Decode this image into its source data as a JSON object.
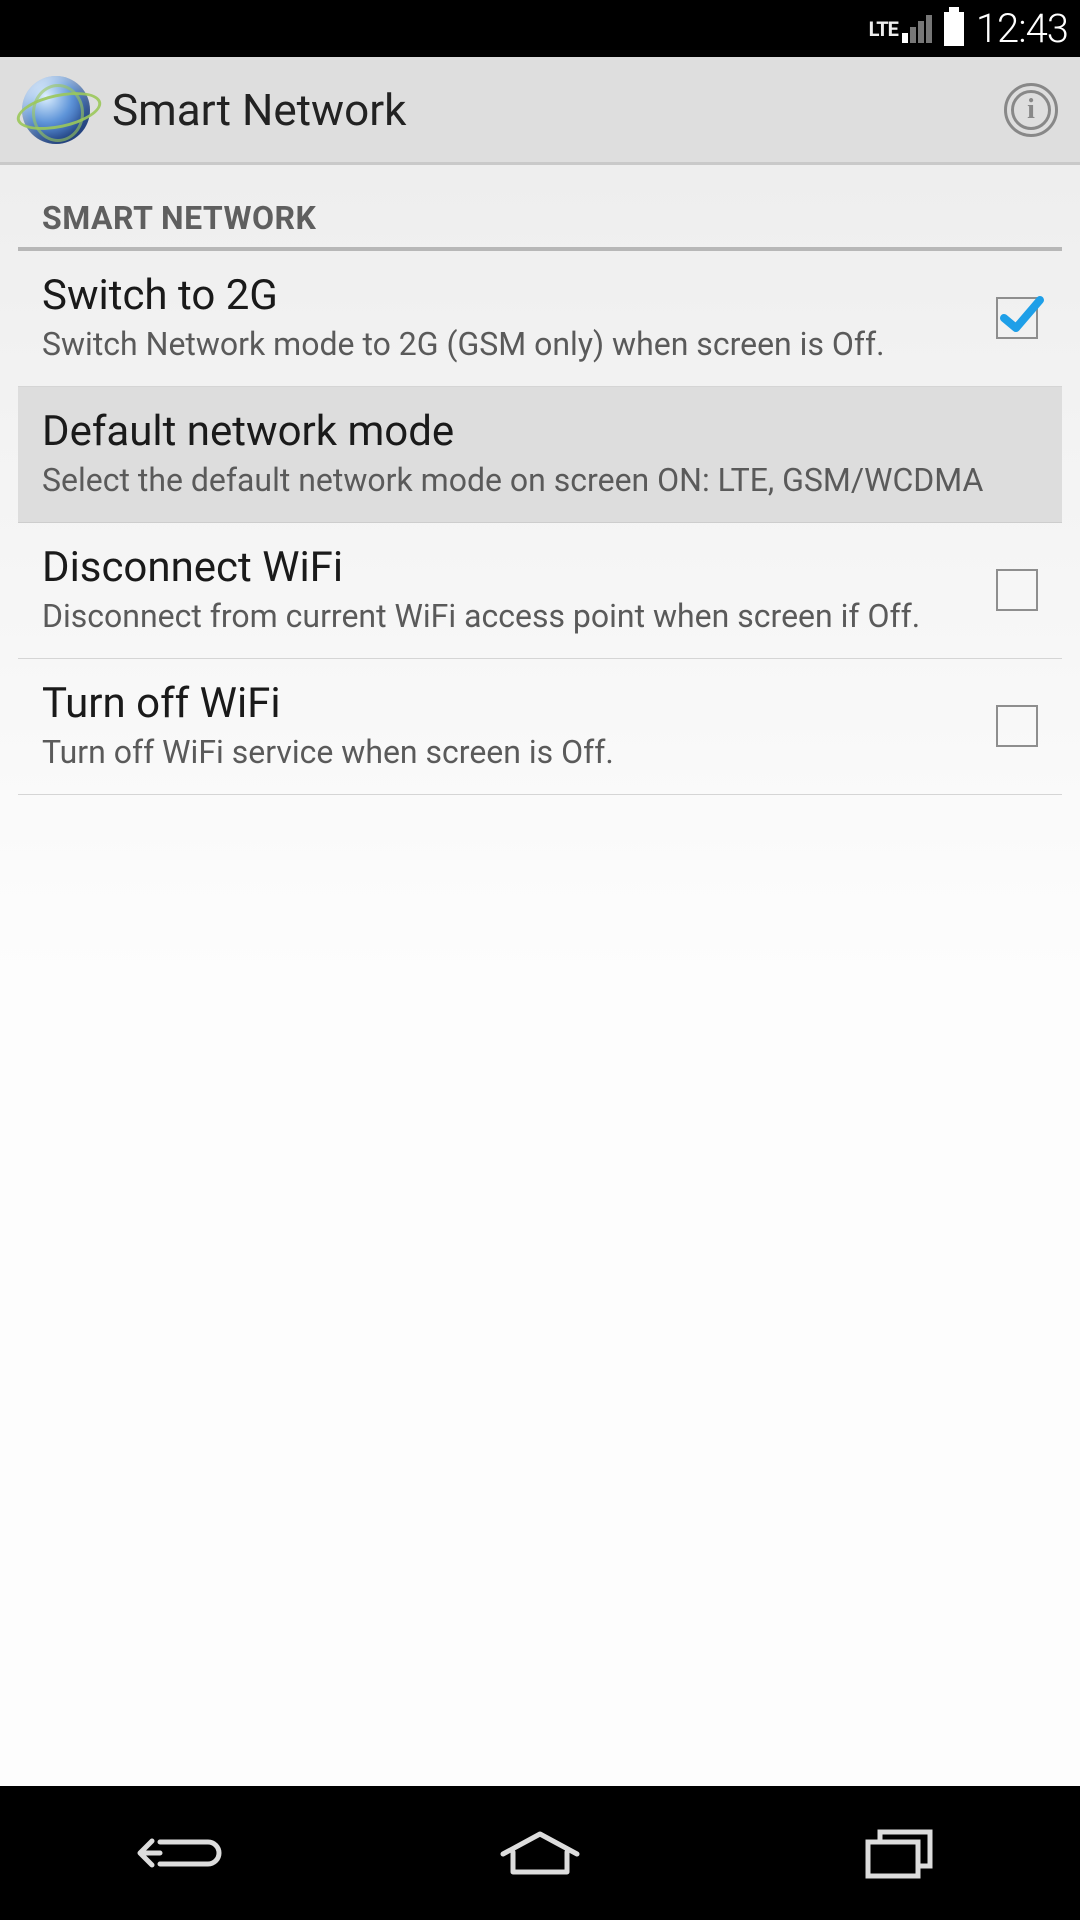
{
  "status": {
    "network_label": "LTE",
    "time": "12:43"
  },
  "actionbar": {
    "title": "Smart Network",
    "icon": "globe-icon",
    "info_icon": "info-icon"
  },
  "section": {
    "header": "SMART NETWORK"
  },
  "prefs": {
    "switch2g": {
      "title": "Switch to 2G",
      "summary": "Switch Network mode to 2G (GSM only) when screen is Off.",
      "checked": true
    },
    "default_mode": {
      "title": "Default network mode",
      "summary": "Select the default network mode on screen ON: LTE, GSM/WCDMA"
    },
    "disconnect_wifi": {
      "title": "Disconnect WiFi",
      "summary": "Disconnect from current WiFi access point when screen if Off.",
      "checked": false
    },
    "turnoff_wifi": {
      "title": "Turn off WiFi",
      "summary": "Turn off WiFi service when screen is Off.",
      "checked": false
    }
  },
  "nav": {
    "back": "back-icon",
    "home": "home-icon",
    "recent": "recent-icon"
  }
}
